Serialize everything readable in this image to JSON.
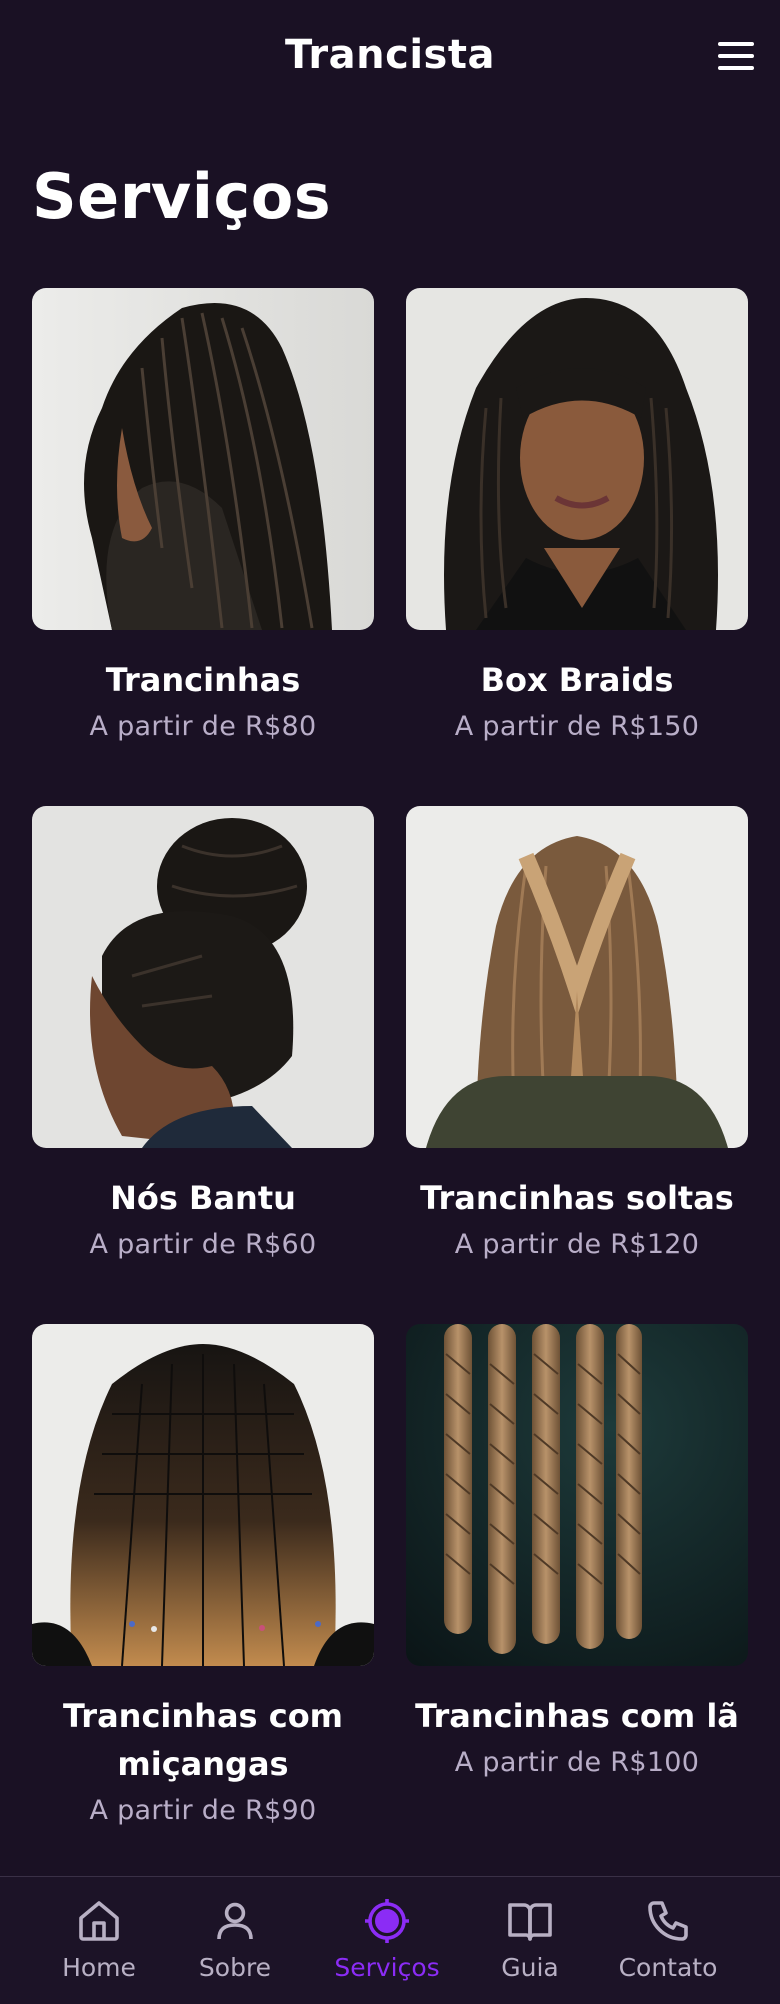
{
  "header": {
    "title": "Trancista"
  },
  "page": {
    "title": "Serviços"
  },
  "services": [
    {
      "name": "Trancinhas",
      "price": "A partir de R$80"
    },
    {
      "name": "Box Braids",
      "price": "A partir de R$150"
    },
    {
      "name": "Nós Bantu",
      "price": "A partir de R$60"
    },
    {
      "name": "Trancinhas soltas",
      "price": "A partir de R$120"
    },
    {
      "name": "Trancinhas com miçangas",
      "price": "A partir de R$90"
    },
    {
      "name": "Trancinhas com lã",
      "price": "A partir de R$100"
    }
  ],
  "nav": {
    "active": "Serviços",
    "items": [
      {
        "label": "Home",
        "icon": "home-icon"
      },
      {
        "label": "Sobre",
        "icon": "user-icon"
      },
      {
        "label": "Serviços",
        "icon": "services-icon"
      },
      {
        "label": "Guia",
        "icon": "book-icon"
      },
      {
        "label": "Contato",
        "icon": "phone-icon"
      }
    ]
  },
  "colors": {
    "background": "#1a1124",
    "accent": "#8b2cf5",
    "muted_text": "#b9aec8"
  }
}
